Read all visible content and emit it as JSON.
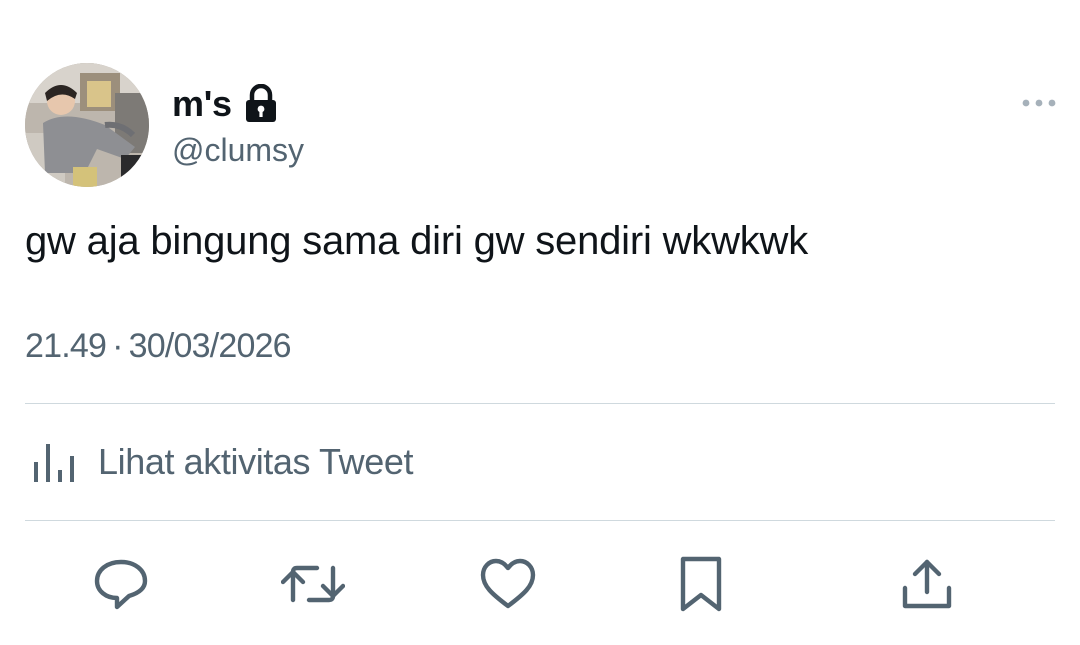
{
  "tweet": {
    "author": {
      "display_name": "m's",
      "handle": "@clumsy",
      "protected_icon": "lock-icon",
      "avatar": "profile-photo"
    },
    "text": "gw aja bingung sama diri gw sendiri wkwkwk",
    "time": "21.49",
    "separator": "·",
    "date": "30/03/2026",
    "activity_label": "Lihat aktivitas Tweet",
    "more_icon": "more-horizontal-icon"
  },
  "actions": [
    {
      "icon": "reply-icon"
    },
    {
      "icon": "retweet-icon"
    },
    {
      "icon": "like-icon"
    },
    {
      "icon": "bookmark-icon"
    },
    {
      "icon": "share-icon"
    }
  ],
  "colors": {
    "text_primary": "#0f1419",
    "text_secondary": "#536471",
    "divider": "#cfd9de",
    "background": "#ffffff"
  }
}
